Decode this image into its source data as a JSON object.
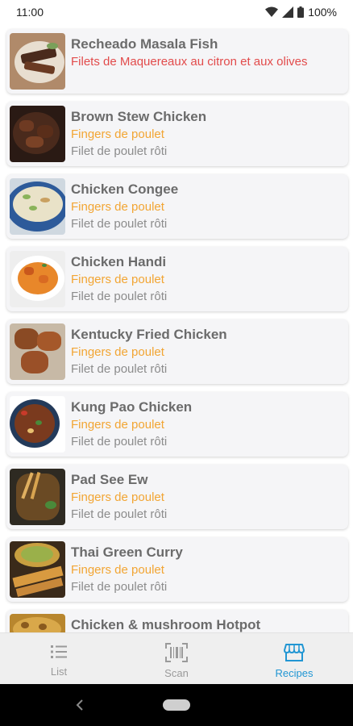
{
  "status_bar": {
    "time": "11:00",
    "battery": "100%"
  },
  "colors": {
    "accent": "#2196d3",
    "subtitle_orange": "#f2a533",
    "subtitle_red": "#e24b4b",
    "nav_inactive": "#9a9a9a"
  },
  "recipes": [
    {
      "title": "Recheado Masala Fish",
      "subtitle1": "Filets de Maquereaux au citron et aux olives",
      "subtitle2": ""
    },
    {
      "title": "Brown Stew Chicken",
      "subtitle1": "Fingers de poulet",
      "subtitle2": "Filet de poulet rôti"
    },
    {
      "title": "Chicken Congee",
      "subtitle1": "Fingers de poulet",
      "subtitle2": "Filet de poulet rôti"
    },
    {
      "title": "Chicken Handi",
      "subtitle1": "Fingers de poulet",
      "subtitle2": "Filet de poulet rôti"
    },
    {
      "title": "Kentucky Fried Chicken",
      "subtitle1": "Fingers de poulet",
      "subtitle2": "Filet de poulet rôti"
    },
    {
      "title": "Kung Pao Chicken",
      "subtitle1": "Fingers de poulet",
      "subtitle2": "Filet de poulet rôti"
    },
    {
      "title": "Pad See Ew",
      "subtitle1": "Fingers de poulet",
      "subtitle2": "Filet de poulet rôti"
    },
    {
      "title": "Thai Green Curry",
      "subtitle1": "Fingers de poulet",
      "subtitle2": "Filet de poulet rôti"
    },
    {
      "title": "Chicken & mushroom Hotpot",
      "subtitle1": "",
      "subtitle2": ""
    }
  ],
  "bottom_nav": {
    "items": [
      {
        "label": "List",
        "icon": "list-icon",
        "active": false
      },
      {
        "label": "Scan",
        "icon": "barcode-icon",
        "active": false
      },
      {
        "label": "Recipes",
        "icon": "store-icon",
        "active": true
      }
    ]
  }
}
